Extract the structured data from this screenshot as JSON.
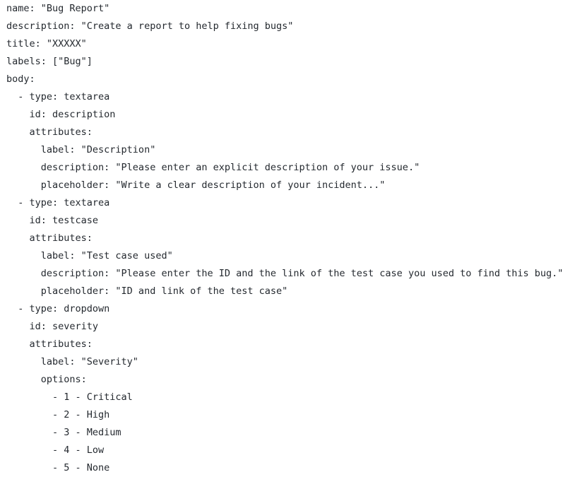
{
  "document": {
    "lines": [
      "name: \"Bug Report\"",
      "description: \"Create a report to help fixing bugs\"",
      "title: \"XXXXX\"",
      "labels: [\"Bug\"]",
      "body:",
      "  - type: textarea",
      "    id: description",
      "    attributes:",
      "      label: \"Description\"",
      "      description: \"Please enter an explicit description of your issue.\"",
      "      placeholder: \"Write a clear description of your incident...\"",
      "  - type: textarea",
      "    id: testcase",
      "    attributes:",
      "      label: \"Test case used\"",
      "      description: \"Please enter the ID and the link of the test case you used to find this bug.\"",
      "      placeholder: \"ID and link of the test case\"",
      "  - type: dropdown",
      "    id: severity",
      "    attributes:",
      "      label: \"Severity\"",
      "      options:",
      "        - 1 - Critical",
      "        - 2 - High",
      "        - 3 - Medium",
      "        - 4 - Low",
      "        - 5 - None"
    ]
  }
}
